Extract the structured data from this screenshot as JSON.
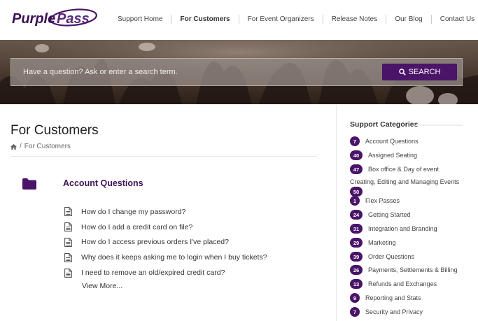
{
  "brand": {
    "name": "PurplePass",
    "color": "#4a1468"
  },
  "nav": {
    "items": [
      {
        "label": "Support Home"
      },
      {
        "label": "For Customers"
      },
      {
        "label": "For Event Organizers"
      },
      {
        "label": "Release Notes"
      },
      {
        "label": "Our Blog"
      },
      {
        "label": "Contact Us"
      }
    ],
    "active": "For Customers"
  },
  "search": {
    "placeholder": "Have a question? Ask or enter a search term.",
    "button_label": "SEARCH",
    "button_icon": "search-icon"
  },
  "page": {
    "title": "For Customers",
    "breadcrumb": {
      "home_icon": "home-icon",
      "separator": "/",
      "current": "For Customers"
    }
  },
  "section": {
    "icon": "folder-icon",
    "title": "Account Questions",
    "articles": [
      "How do I change my password?",
      "How do I add a credit card on file?",
      "How do I access previous orders I've placed?",
      "Why does it keeps asking me to login when I buy tickets?",
      "I need to remove an old/expired credit card?"
    ],
    "view_more": "View More..."
  },
  "sidebar": {
    "title": "Support Categories",
    "categories": [
      {
        "count": "7",
        "label": "Account Questions"
      },
      {
        "count": "40",
        "label": "Assigned Seating"
      },
      {
        "count": "47",
        "label": "Box office & Day of event"
      },
      {
        "count": "50",
        "label": "Creating, Editing and Managing Events"
      },
      {
        "count": "1",
        "label": "Flex Passes"
      },
      {
        "count": "24",
        "label": "Getting Started"
      },
      {
        "count": "31",
        "label": "Integration and Branding"
      },
      {
        "count": "29",
        "label": "Marketing"
      },
      {
        "count": "39",
        "label": "Order Questions"
      },
      {
        "count": "26",
        "label": "Payments, Settlements & Billing"
      },
      {
        "count": "13",
        "label": "Refunds and Exchanges"
      },
      {
        "count": "9",
        "label": "Reporting and Stats"
      },
      {
        "count": "7",
        "label": "Security and Privacy"
      }
    ]
  }
}
